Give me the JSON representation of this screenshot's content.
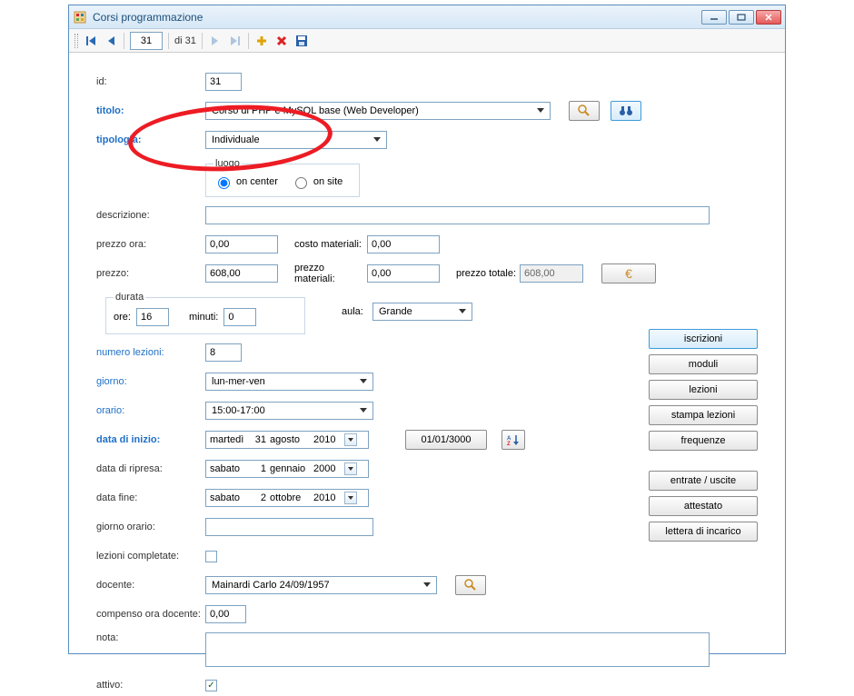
{
  "window": {
    "title": "Corsi programmazione"
  },
  "toolbar": {
    "record": "31",
    "total": "di 31"
  },
  "form": {
    "id_label": "id:",
    "id_value": "31",
    "titolo_label": "titolo:",
    "titolo_value": "Corso di PHP e MySQL base (Web Developer)",
    "tipologia_label": "tipologia:",
    "tipologia_value": "Individuale",
    "luogo_legend": "luogo",
    "luogo_on_center": "on center",
    "luogo_on_site": "on site",
    "descrizione_label": "descrizione:",
    "descrizione_value": "",
    "prezzo_ora_label": "prezzo ora:",
    "prezzo_ora_value": "0,00",
    "costo_materiali_label": "costo materiali:",
    "costo_materiali_value": "0,00",
    "prezzo_label": "prezzo:",
    "prezzo_value": "608,00",
    "prezzo_materiali_label": "prezzo materiali:",
    "prezzo_materiali_value": "0,00",
    "prezzo_totale_label": "prezzo totale:",
    "prezzo_totale_value": "608,00",
    "durata_legend": "durata",
    "ore_label": "ore:",
    "ore_value": "16",
    "minuti_label": "minuti:",
    "minuti_value": "0",
    "aula_label": "aula:",
    "aula_value": "Grande",
    "numero_lezioni_label": "numero lezioni:",
    "numero_lezioni_value": "8",
    "giorno_label": "giorno:",
    "giorno_value": "lun-mer-ven",
    "orario_label": "orario:",
    "orario_value": "15:00-17:00",
    "data_inizio_label": "data di inizio:",
    "data_inizio_day": "martedì",
    "data_inizio_dd": "31",
    "data_inizio_month": "agosto",
    "data_inizio_year": "2010",
    "reset_date_btn": "01/01/3000",
    "data_ripresa_label": "data di ripresa:",
    "data_ripresa_day": "sabato",
    "data_ripresa_dd": "1",
    "data_ripresa_month": "gennaio",
    "data_ripresa_year": "2000",
    "data_fine_label": "data fine:",
    "data_fine_day": "sabato",
    "data_fine_dd": "2",
    "data_fine_month": "ottobre",
    "data_fine_year": "2010",
    "giorno_orario_label": "giorno orario:",
    "giorno_orario_value": "",
    "lezioni_completate_label": "lezioni completate:",
    "docente_label": "docente:",
    "docente_value": "Mainardi Carlo 24/09/1957",
    "compenso_label": "compenso ora docente:",
    "compenso_value": "0,00",
    "nota_label": "nota:",
    "nota_value": "",
    "attivo_label": "attivo:"
  },
  "side_buttons": {
    "iscrizioni": "iscrizioni",
    "moduli": "moduli",
    "lezioni": "lezioni",
    "stampa_lezioni": "stampa lezioni",
    "frequenze": "frequenze",
    "entrate_uscite": "entrate / uscite",
    "attestato": "attestato",
    "lettera_incarico": "lettera di incarico"
  },
  "euro_symbol": "€",
  "checkmark": "✓"
}
